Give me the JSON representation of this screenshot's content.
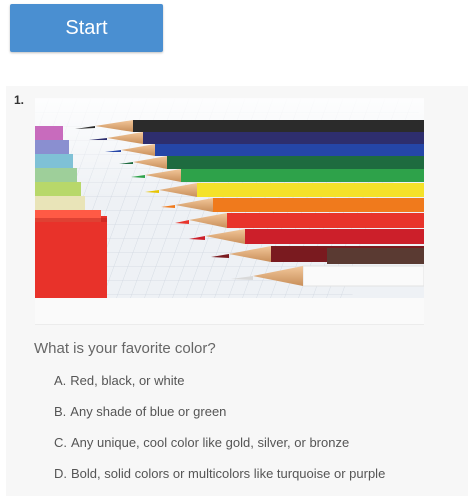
{
  "start_button": {
    "label": "Start"
  },
  "quiz": {
    "question_number": "1.",
    "image_description_icon": "colored-pencils-image",
    "question": "What is your favorite color?",
    "options": [
      {
        "letter": "A.",
        "text": "Red, black, or white"
      },
      {
        "letter": "B.",
        "text": "Any shade of blue or green"
      },
      {
        "letter": "C.",
        "text": "Any unique, cool color like gold, silver, or bronze"
      },
      {
        "letter": "D.",
        "text": "Bold, solid colors or multicolors like turquoise or purple"
      }
    ]
  },
  "colors": {
    "button": "#4a8fd1",
    "card_bg": "#f7f7f7",
    "question_text": "#666666",
    "option_text": "#555555"
  }
}
